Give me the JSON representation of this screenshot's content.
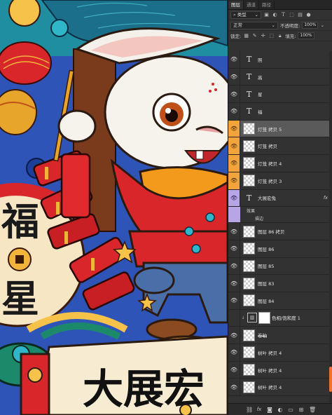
{
  "tabs": [
    "图层",
    "通道",
    "路径"
  ],
  "filter": {
    "label": "类型",
    "icons": [
      "image-filter-icon",
      "adjust-filter-icon",
      "text-filter-icon",
      "shape-filter-icon",
      "smart-filter-icon",
      "toggle-filter-icon"
    ]
  },
  "blend": {
    "mode": "正常",
    "opacity_label": "不透明度:",
    "opacity": "100%"
  },
  "lock": {
    "label": "锁定:",
    "fill_label": "填充:",
    "fill": "100%"
  },
  "layers": [
    {
      "kind": "text",
      "name": "照"
    },
    {
      "kind": "text",
      "name": "高"
    },
    {
      "kind": "text",
      "name": "星"
    },
    {
      "kind": "text",
      "name": "福"
    },
    {
      "kind": "image",
      "name": "灯笼 拷贝 5",
      "selected": true,
      "color": "orange"
    },
    {
      "kind": "image",
      "name": "灯笼 拷贝",
      "color": "orange"
    },
    {
      "kind": "image",
      "name": "灯笼 拷贝 4",
      "color": "orange"
    },
    {
      "kind": "image",
      "name": "灯笼 拷贝 3",
      "color": "orange"
    },
    {
      "kind": "text",
      "name": "大展宏兔",
      "color": "purple",
      "fx": "fx",
      "effects_label": "效果",
      "effect": "描边"
    },
    {
      "kind": "image",
      "name": "图层 86 拷贝"
    },
    {
      "kind": "image",
      "name": "图层 86"
    },
    {
      "kind": "image",
      "name": "图层 85"
    },
    {
      "kind": "image",
      "name": "图层 83"
    },
    {
      "kind": "image",
      "name": "图层 84"
    },
    {
      "kind": "adjust",
      "name": "色相/饱和度 1",
      "hidden": true
    },
    {
      "kind": "image",
      "name": "卷轴",
      "strike": true
    },
    {
      "kind": "image",
      "name": "树叶 拷贝 4"
    },
    {
      "kind": "image",
      "name": "树叶 拷贝 4"
    },
    {
      "kind": "image",
      "name": "树叶 拷贝 4"
    }
  ],
  "footer_icons": [
    "link-icon",
    "fx-icon",
    "mask-icon",
    "adjustment-icon",
    "group-icon",
    "new-layer-icon",
    "delete-icon"
  ],
  "artwork": {
    "vertical_text": [
      "福",
      "星"
    ],
    "banner_text": "大展宏"
  },
  "colors": {
    "accent": "#f0722d",
    "orange_tag": "#f2a33a",
    "purple_tag": "#b7a5e6",
    "selected": "#5a5a5a"
  }
}
